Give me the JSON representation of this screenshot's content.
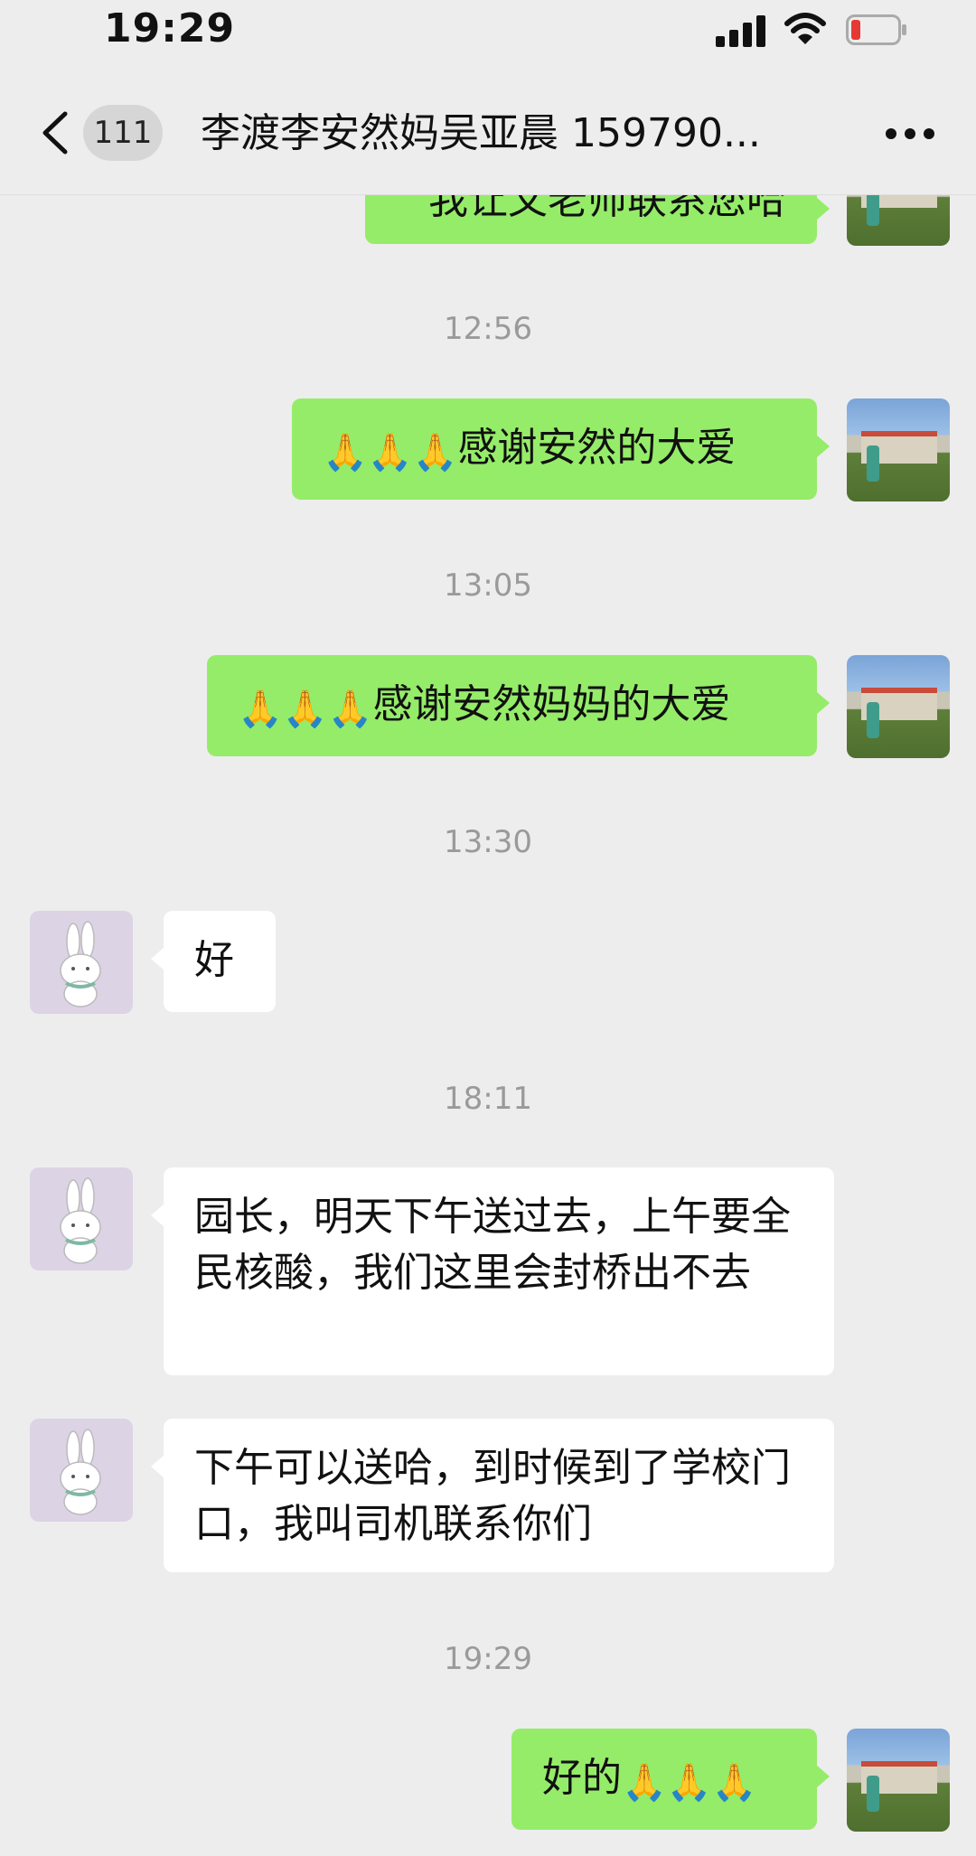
{
  "status_bar": {
    "time": "19:29"
  },
  "nav": {
    "unread_count": "111",
    "title": "李渡李安然妈吴亚晨 159790..."
  },
  "messages": [
    {
      "type": "sent",
      "text": "我让文老师联系您哈"
    },
    {
      "type": "time",
      "text": "12:56"
    },
    {
      "type": "sent",
      "prefix_icons": [
        "pray-icon",
        "pray-icon",
        "pray-icon"
      ],
      "text": "感谢安然的大爱"
    },
    {
      "type": "time",
      "text": "13:05"
    },
    {
      "type": "sent",
      "prefix_icons": [
        "pray-icon",
        "pray-icon",
        "pray-icon"
      ],
      "text": "感谢安然妈妈的大爱"
    },
    {
      "type": "time",
      "text": "13:30"
    },
    {
      "type": "received",
      "text": "好"
    },
    {
      "type": "time",
      "text": "18:11"
    },
    {
      "type": "received",
      "text": "园长，明天下午送过去，上午要全民核酸，我们这里会封桥出不去"
    },
    {
      "type": "received",
      "text": "下午可以送哈，到时候到了学校门口，我叫司机联系你们"
    },
    {
      "type": "time",
      "text": "19:29"
    },
    {
      "type": "sent",
      "text": "好的",
      "suffix_icons": [
        "pray-icon",
        "pray-icon",
        "pray-icon"
      ]
    }
  ],
  "icons": {
    "pray": "🙏"
  }
}
